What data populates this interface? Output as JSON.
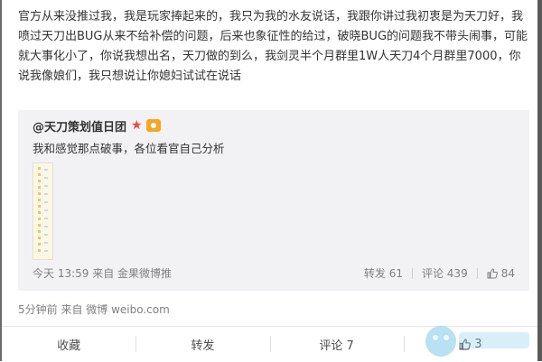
{
  "post": {
    "text": "官方从来没推过我，我是玩家捧起来的，我只为我的水友说话，我跟你讲过我初衷是为天刀好，我喷过天刀出BUG从来不给补偿的问题，后来也象征性的给过，破晓BUG的问题我不带头闹事，可能就大事化小了，你说我想出名，天刀做的到么，我剑灵半个月群里1W人天刀4个月群里7000，你说我像娘们，我只想说让你媳妇试试在说话",
    "meta": "5分钟前 来自 微博 weibo.com"
  },
  "quote": {
    "author": "@天刀策划值日团",
    "text": "我和感觉那点破事，各位看官自己分析",
    "meta": "今天 13:59 来自 金果微博推",
    "repost_label": "转发 61",
    "comment_label": "评论 439",
    "like_count": "84"
  },
  "actions": {
    "favorite": "收藏",
    "repost": "转发",
    "comment": "评论 7",
    "like_count": "3"
  },
  "colors": {
    "accent_star": "#e84a3c",
    "badge": "#f5a623",
    "quote_bg": "#f2f2f5"
  }
}
